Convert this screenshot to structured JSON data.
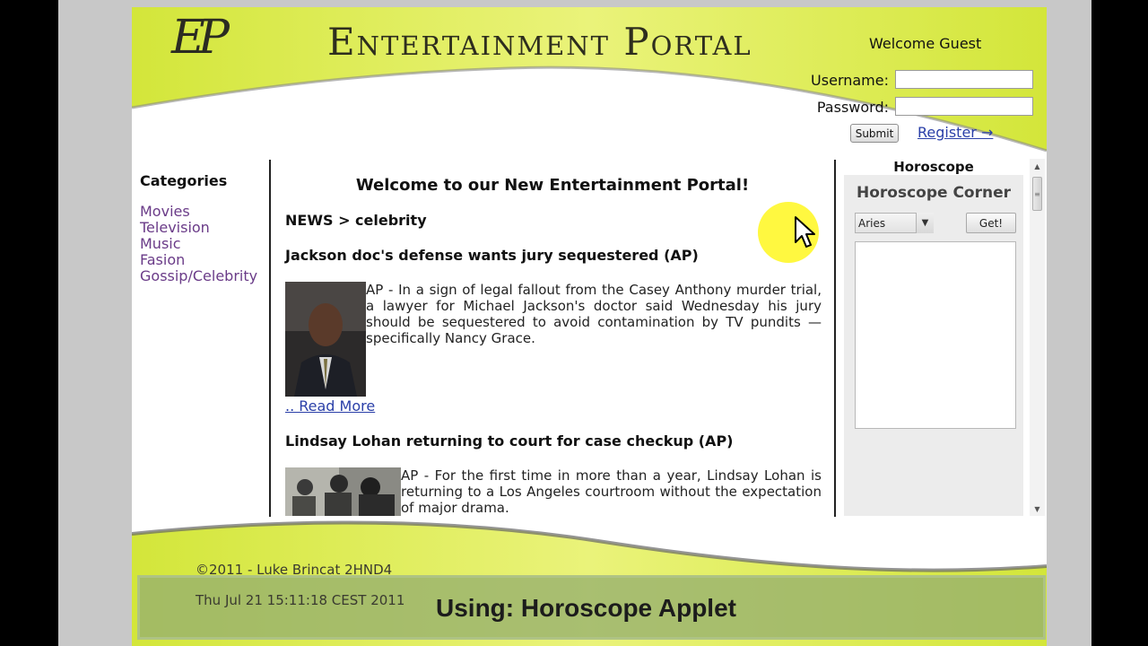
{
  "header": {
    "logo": "EP",
    "title": "Entertainment Portal",
    "welcome": "Welcome Guest",
    "username_label": "Username:",
    "password_label": "Password:",
    "username_value": "",
    "password_value": "",
    "submit_label": "Submit",
    "register_label": "Register →"
  },
  "sidebar": {
    "title": "Categories",
    "items": [
      "Movies",
      "Television",
      "Music",
      "Fasion",
      "Gossip/Celebrity"
    ]
  },
  "main": {
    "title": "Welcome to our New Entertainment Portal!",
    "breadcrumb": "NEWS > celebrity",
    "articles": [
      {
        "title": "Jackson doc's defense wants jury sequestered (AP)",
        "text": "AP - In a sign of legal fallout from the Casey Anthony murder trial, a lawyer for Michael Jackson's doctor said Wednesday his jury should be sequestered to avoid contamination by TV pundits — specifically Nancy Grace.",
        "read_more": ".. Read More"
      },
      {
        "title": "Lindsay Lohan returning to court for case checkup (AP)",
        "text": "AP - For the first time in more than a year, Lindsay Lohan is returning to a Los Angeles courtroom without the expectation of major drama."
      }
    ]
  },
  "horoscope": {
    "heading": "Horoscope",
    "applet_title": "Horoscope Corner",
    "selected_sign": "Aries",
    "get_label": "Get!",
    "result": ""
  },
  "footer": {
    "copyright": "©2011 - Luke Brincat 2HND4",
    "datetime": "Thu Jul 21 15:11:18 CEST 2011"
  },
  "caption": "Using: Horoscope Applet",
  "colors": {
    "lime": "#d6e83a",
    "lime_light": "#eef58a",
    "link": "#2a3fa8",
    "category": "#6a3b88"
  }
}
